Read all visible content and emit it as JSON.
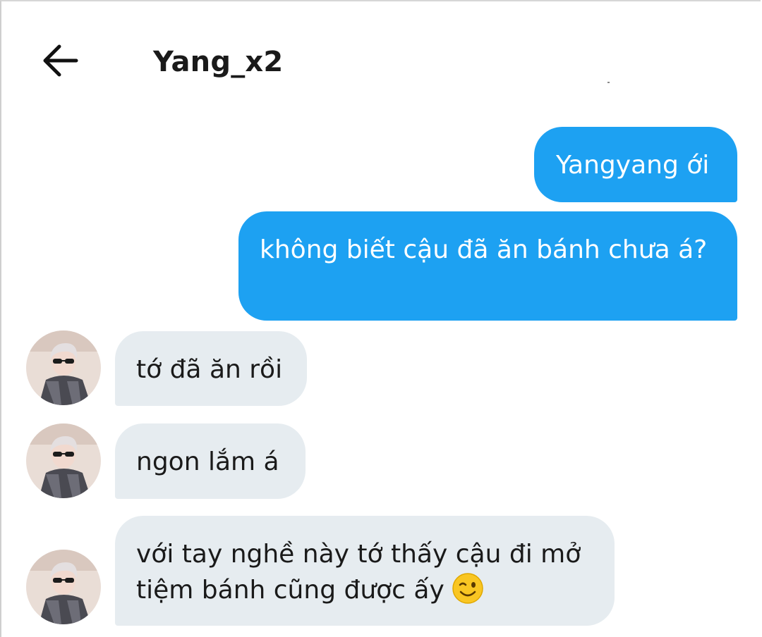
{
  "header": {
    "title": "Yang_x2",
    "back_icon": "arrow-left-icon"
  },
  "messages": [
    {
      "side": "outgoing",
      "text": "Yangyang ới"
    },
    {
      "side": "outgoing",
      "text": "không biết cậu đã ăn bánh chưa á?"
    },
    {
      "side": "incoming",
      "text": "tớ đã ăn rồi",
      "avatar": "avatar-photo"
    },
    {
      "side": "incoming",
      "text": "ngon lắm á",
      "avatar": "avatar-photo"
    },
    {
      "side": "incoming",
      "text": "với tay nghề này tớ thấy cậu đi mở tiệm bánh cũng được ấy",
      "emoji": "winking-face-emoji",
      "avatar": "avatar-photo"
    }
  ],
  "colors": {
    "outgoing_bubble": "#1da1f2",
    "incoming_bubble": "#e6ecf0",
    "title_text": "#1a1a1a"
  }
}
